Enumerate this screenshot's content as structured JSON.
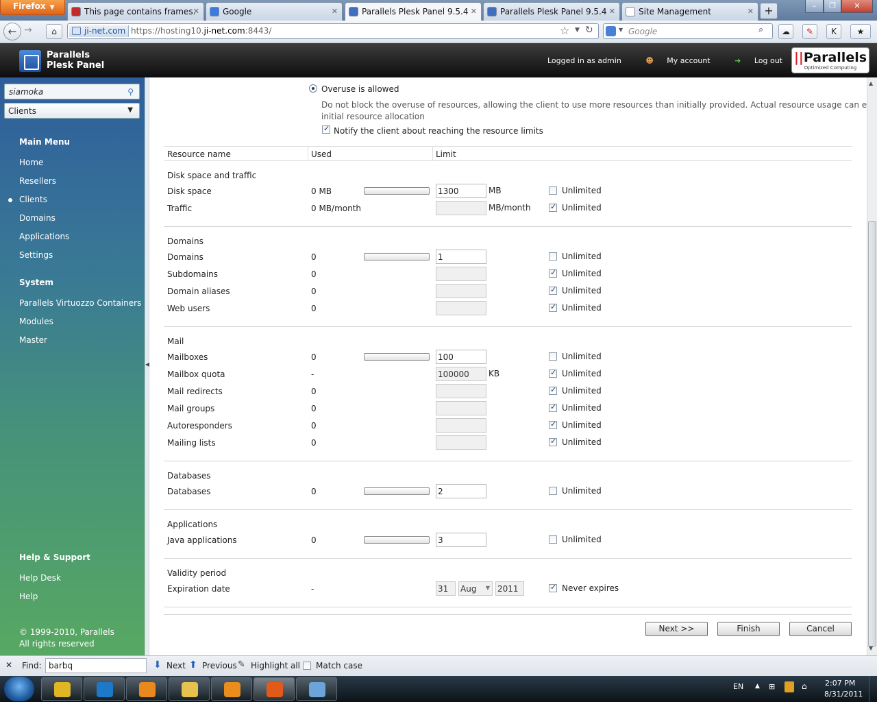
{
  "browser": {
    "menu_button": "Firefox",
    "tabs": [
      {
        "label": "This page contains frames.",
        "color": "#c62b2b"
      },
      {
        "label": "Google",
        "color": "#3b7be0"
      },
      {
        "label": "Parallels Plesk Panel 9.5.4",
        "color": "#3e6fbf"
      },
      {
        "label": "Parallels Plesk Panel 9.5.4",
        "color": "#3e6fbf"
      },
      {
        "label": "Site Management",
        "color": "#ffffff"
      }
    ],
    "new_tab": "+",
    "url_identity": "ji-net.com",
    "url_prefix": "https://hosting10.",
    "url_domain": "ji-net.com",
    "url_suffix": ":8443/",
    "search_placeholder": "Google"
  },
  "header": {
    "title_line1": "Parallels",
    "title_line2": "Plesk Panel",
    "logged_in": "Logged in as admin",
    "my_account": "My account",
    "log_out": "Log out",
    "brand": "Parallels",
    "brand_tagline": "Optimized Computing"
  },
  "sidebar": {
    "search_value": "siamoka",
    "scope_select": "Clients",
    "main_menu_title": "Main Menu",
    "main_menu": [
      "Home",
      "Resellers",
      "Clients",
      "Domains",
      "Applications",
      "Settings"
    ],
    "system_title": "System",
    "system_menu": [
      "Parallels Virtuozzo Containers",
      "Modules",
      "Master"
    ],
    "help_title": "Help & Support",
    "help_menu": [
      "Help Desk",
      "Help"
    ],
    "copyright": "© 1999-2010, Parallels",
    "rights": "All rights reserved"
  },
  "overuse": {
    "option_label": "Overuse is allowed",
    "description_line1": "Do not block the overuse of resources, allowing the client to use more resources than initially provided. Actual resource usage can exceed the",
    "description_line2": "initial resource allocation",
    "notify_label": "Notify the client about reaching the resource limits"
  },
  "table": {
    "columns": [
      "Resource name",
      "Used",
      "Limit"
    ],
    "unlimited_label": "Unlimited",
    "sections": [
      {
        "title": "Disk space and traffic",
        "rows": [
          {
            "name": "Disk space",
            "used": "0 MB",
            "bar": true,
            "limit": "1300",
            "unit": "MB",
            "unlimited": false
          },
          {
            "name": "Traffic",
            "used": "0 MB/month",
            "bar": false,
            "limit": "",
            "unit": "MB/month",
            "unlimited": true
          }
        ]
      },
      {
        "title": "Domains",
        "rows": [
          {
            "name": "Domains",
            "used": "0",
            "bar": true,
            "limit": "1",
            "unit": "",
            "unlimited": false
          },
          {
            "name": "Subdomains",
            "used": "0",
            "bar": false,
            "limit": "",
            "unit": "",
            "unlimited": true
          },
          {
            "name": "Domain aliases",
            "used": "0",
            "bar": false,
            "limit": "",
            "unit": "",
            "unlimited": true
          },
          {
            "name": "Web users",
            "used": "0",
            "bar": false,
            "limit": "",
            "unit": "",
            "unlimited": true
          }
        ]
      },
      {
        "title": "Mail",
        "rows": [
          {
            "name": "Mailboxes",
            "used": "0",
            "bar": true,
            "limit": "100",
            "unit": "",
            "unlimited": false
          },
          {
            "name": "Mailbox quota",
            "used": "-",
            "bar": false,
            "limit": "100000",
            "unit": "KB",
            "unlimited": true
          },
          {
            "name": "Mail redirects",
            "used": "0",
            "bar": false,
            "limit": "",
            "unit": "",
            "unlimited": true
          },
          {
            "name": "Mail groups",
            "used": "0",
            "bar": false,
            "limit": "",
            "unit": "",
            "unlimited": true
          },
          {
            "name": "Autoresponders",
            "used": "0",
            "bar": false,
            "limit": "",
            "unit": "",
            "unlimited": true
          },
          {
            "name": "Mailing lists",
            "used": "0",
            "bar": false,
            "limit": "",
            "unit": "",
            "unlimited": true
          }
        ]
      },
      {
        "title": "Databases",
        "rows": [
          {
            "name": "Databases",
            "used": "0",
            "bar": true,
            "limit": "2",
            "unit": "",
            "unlimited": false
          }
        ]
      },
      {
        "title": "Applications",
        "rows": [
          {
            "name": "Java applications",
            "used": "0",
            "bar": true,
            "limit": "3",
            "unit": "",
            "unlimited": false
          }
        ]
      }
    ],
    "validity": {
      "title": "Validity period",
      "name": "Expiration date",
      "used": "-",
      "day": "31",
      "month": "Aug",
      "year": "2011",
      "never_label": "Never expires",
      "never_expires": true
    }
  },
  "buttons": {
    "next": "Next >>",
    "finish": "Finish",
    "cancel": "Cancel"
  },
  "findbar": {
    "label": "Find:",
    "value": "barbq",
    "next": "Next",
    "previous": "Previous",
    "highlight": "Highlight all",
    "match_case": "Match case"
  },
  "taskbar": {
    "language": "EN",
    "time": "2:07 PM",
    "date": "8/31/2011",
    "apps": [
      "#e0b526",
      "#1e78c8",
      "#e8881e",
      "#e7c14e",
      "#e98e1c",
      "#e05a1a",
      "#6aa4d9"
    ]
  }
}
